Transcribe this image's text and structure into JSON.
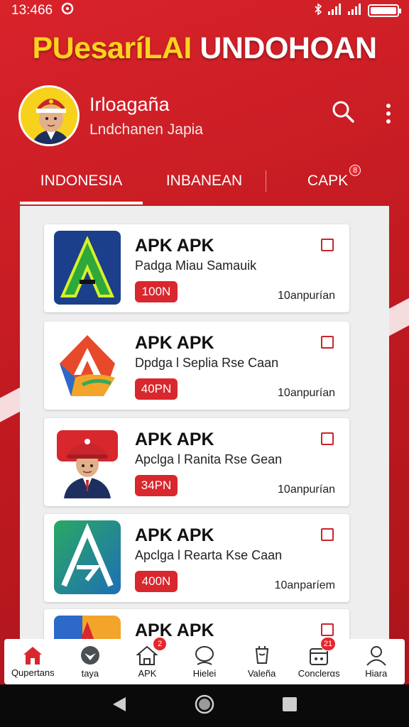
{
  "status_bar": {
    "time": "13:466"
  },
  "app_title": {
    "part1": "PUesaríLAI",
    "part2": "UNDOHOAN"
  },
  "profile": {
    "name": "Irloagaña",
    "subtitle": "Lndchanen Japia"
  },
  "tabs": [
    {
      "label": "INDONESIA",
      "active": true
    },
    {
      "label": "INBANEAN",
      "active": false
    },
    {
      "label": "CAPK",
      "active": false,
      "badge": "8"
    }
  ],
  "apps": [
    {
      "title": "APK APK",
      "subtitle": "Padga Miau Samauik",
      "pill": "100N",
      "meta": "10anpurían",
      "icon": "letter-a-green-icon"
    },
    {
      "title": "APK APK",
      "subtitle": "Dpdga l Seplia Rse Caan",
      "pill": "40PN",
      "meta": "10anpurían",
      "icon": "letter-a-colorful-icon"
    },
    {
      "title": "APK APK",
      "subtitle": "Apclga l Ranita Rse Gean",
      "pill": "34PN",
      "meta": "10anpurían",
      "icon": "official-portrait-icon"
    },
    {
      "title": "APK APK",
      "subtitle": "Apclga l Rearta Kse Caan",
      "pill": "400N",
      "meta": "10anparíem",
      "icon": "letter-a-green-square-icon"
    },
    {
      "title": "APK APK",
      "subtitle": "",
      "pill": "",
      "meta": "",
      "icon": "letter-a-orange-icon"
    }
  ],
  "bottom_nav": [
    {
      "label": "Qupertans",
      "icon": "home-icon"
    },
    {
      "label": "taya",
      "icon": "heart-shield-icon"
    },
    {
      "label": "APK",
      "icon": "apk-house-icon",
      "badge": "2"
    },
    {
      "label": "Hielei",
      "icon": "chat-bubble-icon"
    },
    {
      "label": "Valeña",
      "icon": "cup-icon"
    },
    {
      "label": "Conclerαs",
      "icon": "calendar-icon",
      "badge": "21"
    },
    {
      "label": "Hiara",
      "icon": "person-icon"
    }
  ],
  "colors": {
    "primary_red": "#d8272d",
    "accent_yellow": "#ffd21f"
  }
}
